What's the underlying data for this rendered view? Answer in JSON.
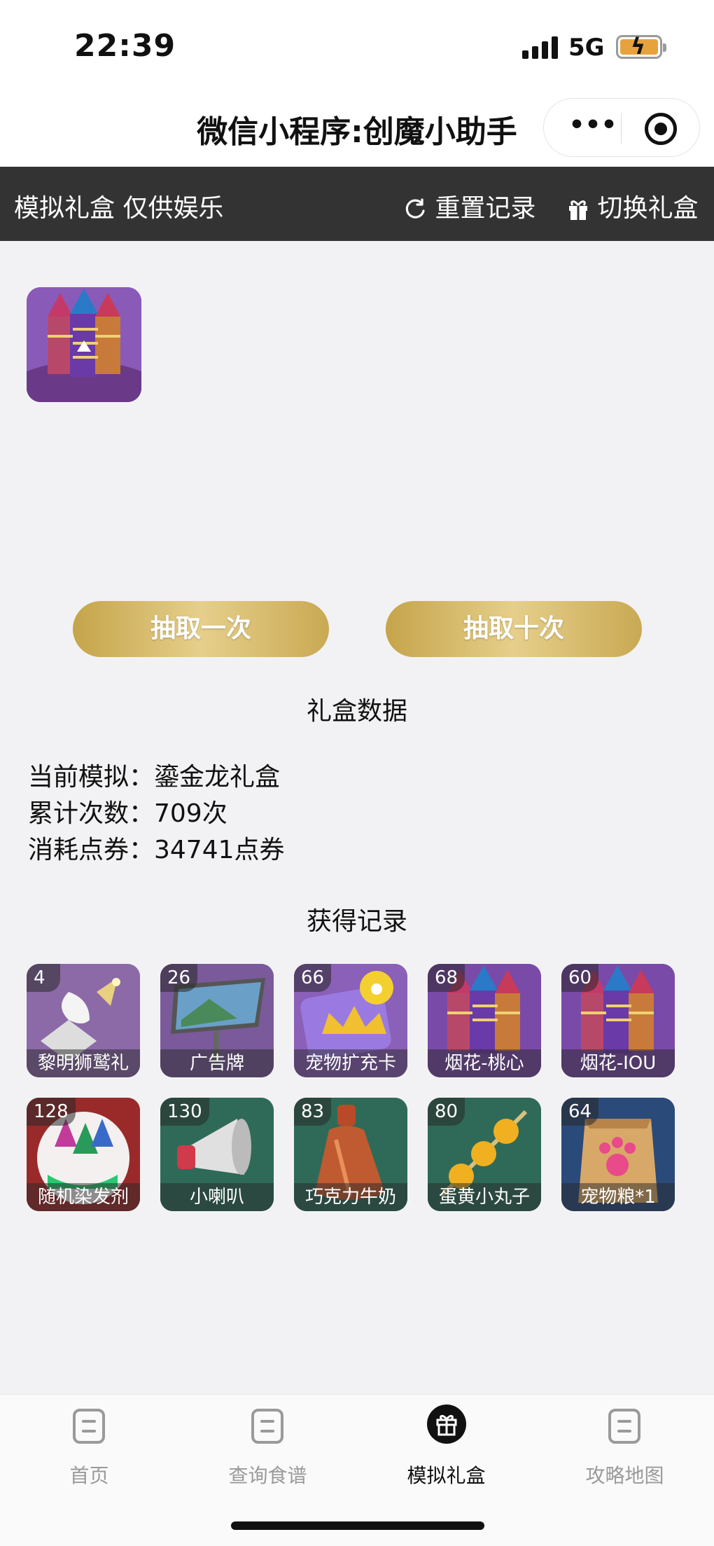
{
  "status": {
    "time": "22:39",
    "network": "5G"
  },
  "header": {
    "title": "微信小程序:创魔小助手",
    "more_label": "•••"
  },
  "banner": {
    "label": "模拟礼盒 仅供娱乐",
    "reset_label": "重置记录",
    "switch_label": "切换礼盒"
  },
  "actions": {
    "draw_one": "抽取一次",
    "draw_ten": "抽取十次"
  },
  "stats": {
    "title": "礼盒数据",
    "rows": [
      {
        "key": "当前模拟：",
        "value": "鎏金龙礼盒"
      },
      {
        "key": "累计次数：",
        "value": "709次"
      },
      {
        "key": "消耗点券：",
        "value": "34741点券"
      }
    ]
  },
  "records": {
    "title": "获得记录",
    "items": [
      {
        "count": "4",
        "name": "黎明狮鹫礼",
        "icon": "griffin-icon",
        "bg": "#8c6aa8"
      },
      {
        "count": "26",
        "name": "广告牌",
        "icon": "billboard-icon",
        "bg": "#7a5a9a"
      },
      {
        "count": "66",
        "name": "宠物扩充卡",
        "icon": "pet-card-icon",
        "bg": "#8a60b8"
      },
      {
        "count": "68",
        "name": "烟花-桃心",
        "icon": "firework-icon",
        "bg": "#7a4aa8"
      },
      {
        "count": "60",
        "name": "烟花-IOU",
        "icon": "firework-icon",
        "bg": "#7a4aa8"
      },
      {
        "count": "128",
        "name": "随机染发剂",
        "icon": "dye-icon",
        "bg": "#9a2a2a"
      },
      {
        "count": "130",
        "name": "小喇叭",
        "icon": "megaphone-icon",
        "bg": "#2f6a58"
      },
      {
        "count": "83",
        "name": "巧克力牛奶",
        "icon": "milk-bottle-icon",
        "bg": "#2f6a58"
      },
      {
        "count": "80",
        "name": "蛋黄小丸子",
        "icon": "egg-balls-icon",
        "bg": "#2f6a58"
      },
      {
        "count": "64",
        "name": "宠物粮*1",
        "icon": "pet-food-icon",
        "bg": "#2a4a7a"
      }
    ]
  },
  "tabs": [
    {
      "label": "首页",
      "icon": "document-icon"
    },
    {
      "label": "查询食谱",
      "icon": "document-icon"
    },
    {
      "label": "模拟礼盒",
      "icon": "gift-icon",
      "active": true
    },
    {
      "label": "攻略地图",
      "icon": "document-icon"
    }
  ]
}
